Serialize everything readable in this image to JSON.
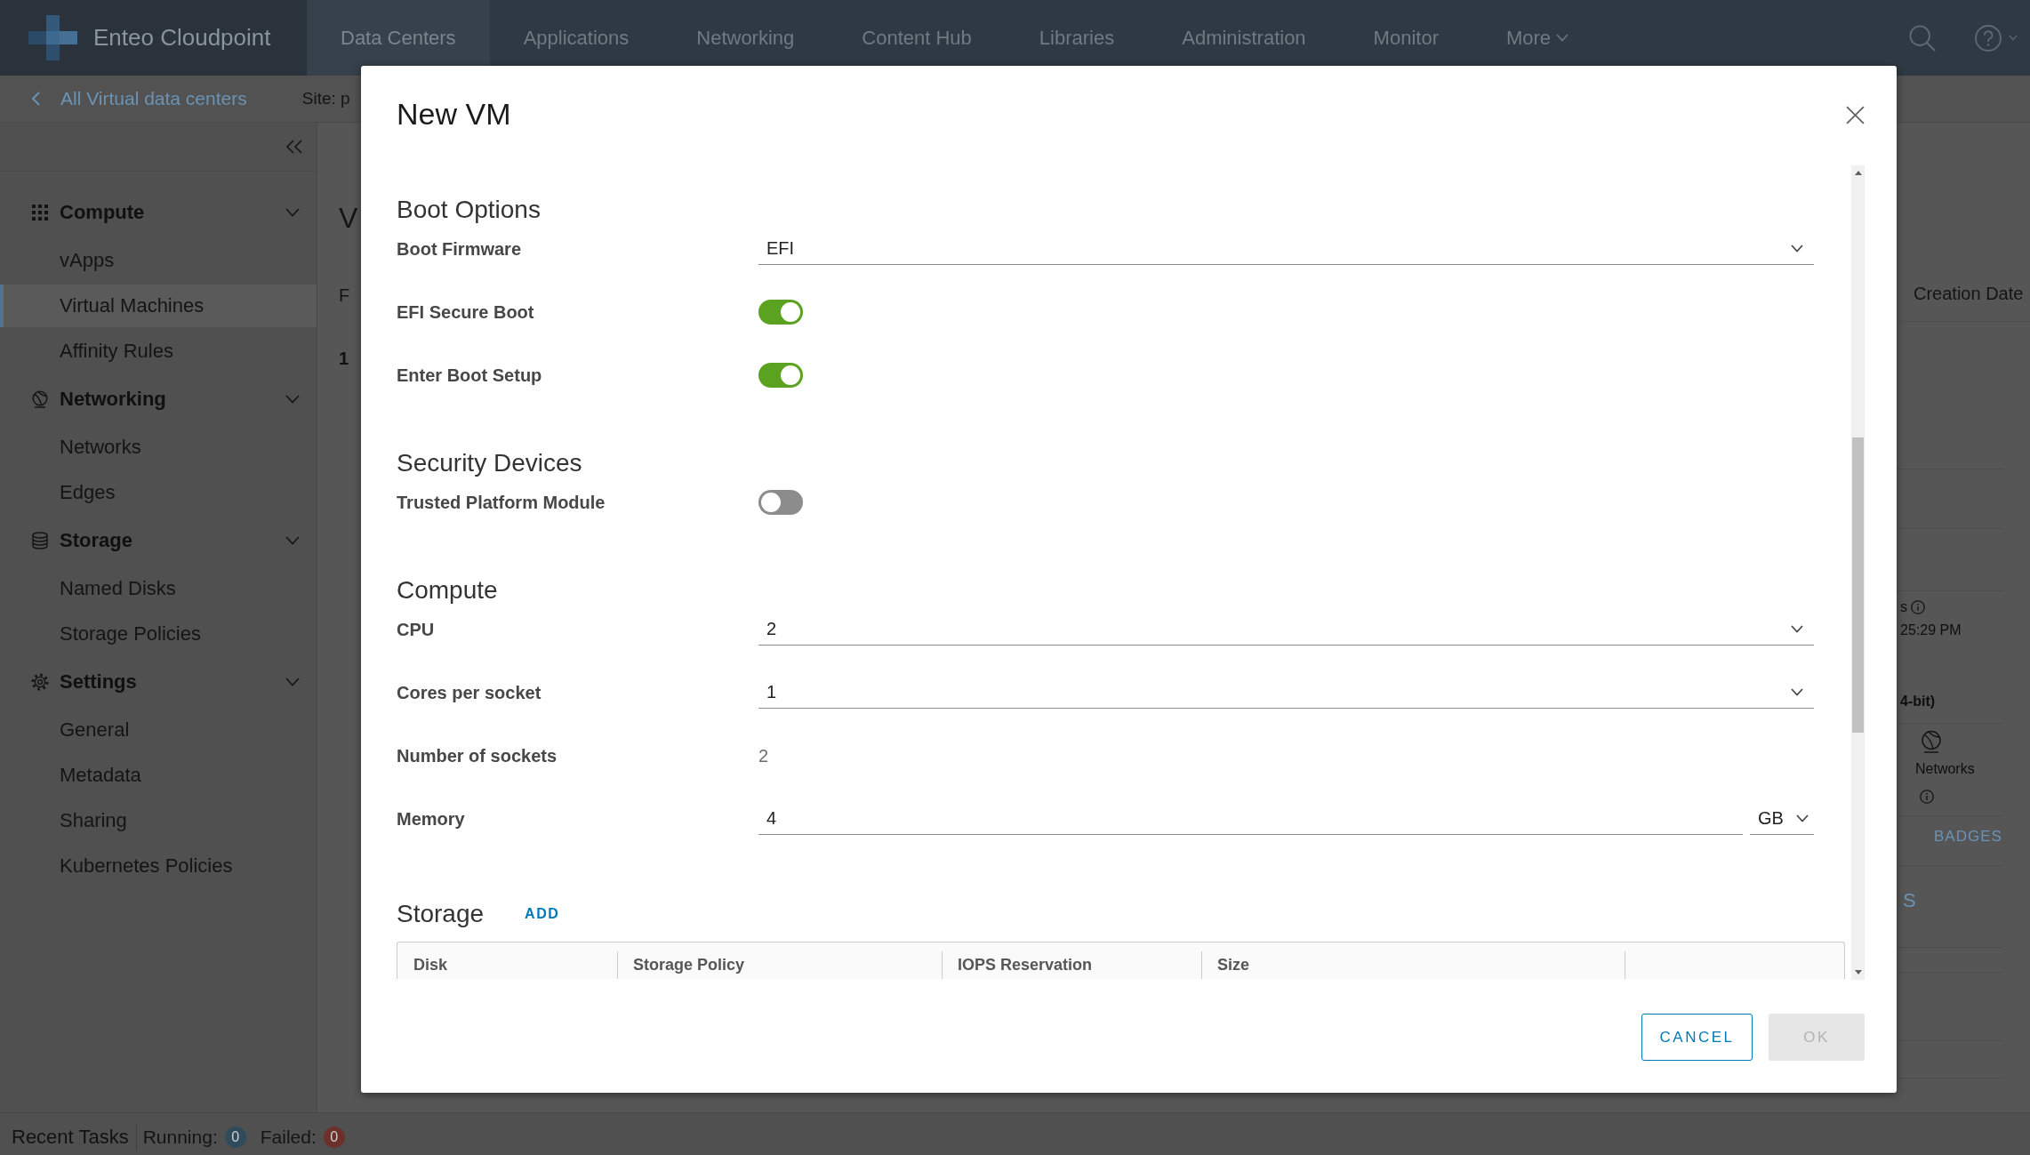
{
  "top_bar": {
    "brand": "Enteo Cloudpoint",
    "nav": [
      {
        "label": "Data Centers",
        "kind": "link",
        "selected": true
      },
      {
        "label": "Applications",
        "kind": "link",
        "selected": false
      },
      {
        "label": "Networking",
        "kind": "link",
        "selected": false
      },
      {
        "label": "Content Hub",
        "kind": "link",
        "selected": false
      },
      {
        "label": "Libraries",
        "kind": "link",
        "selected": false
      },
      {
        "label": "Administration",
        "kind": "link",
        "selected": false
      },
      {
        "label": "Monitor",
        "kind": "link",
        "selected": false
      },
      {
        "label": "More",
        "kind": "menu",
        "selected": false
      }
    ]
  },
  "breadcrumb": {
    "back_link": "All Virtual data centers",
    "site": "Site: p"
  },
  "sidebar": {
    "groups": [
      {
        "title": "Compute",
        "expanded": true,
        "items": [
          {
            "label": "vApps",
            "selected": false
          },
          {
            "label": "Virtual Machines",
            "selected": true
          },
          {
            "label": "Affinity Rules",
            "selected": false
          }
        ]
      },
      {
        "title": "Networking",
        "expanded": true,
        "items": [
          {
            "label": "Networks",
            "selected": false
          },
          {
            "label": "Edges",
            "selected": false
          }
        ]
      },
      {
        "title": "Storage",
        "expanded": true,
        "items": [
          {
            "label": "Named Disks",
            "selected": false
          },
          {
            "label": "Storage Policies",
            "selected": false
          }
        ]
      },
      {
        "title": "Settings",
        "expanded": true,
        "items": [
          {
            "label": "General",
            "selected": false
          },
          {
            "label": "Metadata",
            "selected": false
          },
          {
            "label": "Sharing",
            "selected": false
          },
          {
            "label": "Kubernetes Policies",
            "selected": false
          }
        ]
      }
    ]
  },
  "page_behind": {
    "heading_fragment": "V",
    "text_fragment": "F",
    "number_fragment": "1",
    "column_header": "Creation Date",
    "label_fragment": "s",
    "time_fragment": "25:29 PM",
    "bold_fragment": "4-bit)",
    "networks_label": "Networks",
    "badges_link": "BADGES",
    "tab_fragment": "S"
  },
  "dialog": {
    "title": "New VM",
    "sections": [
      {
        "heading": "Boot Options",
        "rows": [
          {
            "kind": "select",
            "label": "Boot Firmware",
            "value": "EFI"
          },
          {
            "kind": "toggle",
            "label": "EFI Secure Boot",
            "on": true
          },
          {
            "kind": "toggle",
            "label": "Enter Boot Setup",
            "on": true
          }
        ]
      },
      {
        "heading": "Security Devices",
        "rows": [
          {
            "kind": "toggle",
            "label": "Trusted Platform Module",
            "on": false
          }
        ]
      },
      {
        "heading": "Compute",
        "rows": [
          {
            "kind": "select",
            "label": "CPU",
            "value": "2"
          },
          {
            "kind": "select",
            "label": "Cores per socket",
            "value": "1"
          },
          {
            "kind": "readonly",
            "label": "Number of sockets",
            "value": "2"
          },
          {
            "kind": "unitinput",
            "label": "Memory",
            "value": "4",
            "unit": "GB"
          }
        ]
      }
    ],
    "storage": {
      "heading": "Storage",
      "add_link": "ADD",
      "columns": [
        "Disk",
        "Storage Policy",
        "IOPS Reservation",
        "Size"
      ]
    },
    "buttons": [
      {
        "label": "CANCEL",
        "kind": "outline",
        "disabled": false
      },
      {
        "label": "OK",
        "kind": "solid",
        "disabled": true
      }
    ]
  },
  "status_bar": {
    "title": "Recent Tasks",
    "counters": [
      {
        "label": "Running:",
        "count": "0",
        "color": "#2f4b5c"
      },
      {
        "label": "Failed:",
        "count": "0",
        "color": "#6b302a"
      }
    ]
  }
}
